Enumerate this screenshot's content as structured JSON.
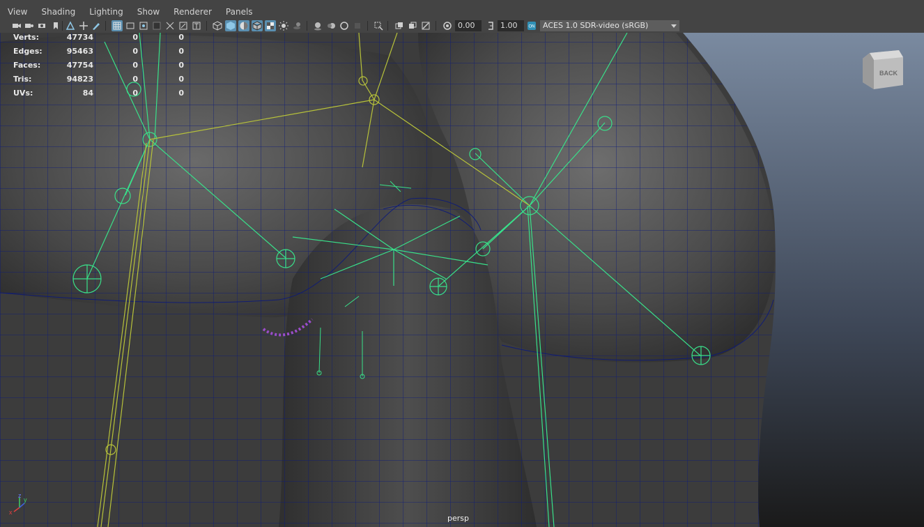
{
  "menubar": {
    "items": [
      "View",
      "Shading",
      "Lighting",
      "Show",
      "Renderer",
      "Panels"
    ]
  },
  "toolbar": {
    "near_value": "0.00",
    "far_value": "1.00",
    "color_space": "ACES 1.0 SDR-video (sRGB)",
    "icons": [
      "camera-icon",
      "select-camera-icon",
      "camera-attributes-icon",
      "bookmark-icon",
      "image-plane-icon",
      "2d-pan-zoom-icon",
      "grease-pencil-icon",
      "grid-icon",
      "film-gate-icon",
      "resolution-gate-icon",
      "gate-mask-icon",
      "field-chart-icon",
      "safe-action-icon",
      "safe-title-icon",
      "wireframe-icon",
      "smooth-shade-icon",
      "default-material-icon",
      "wireframe-on-shaded-icon",
      "textured-icon",
      "lighting-icon",
      "shadows-icon",
      "screen-space-ao-icon",
      "motion-blur-icon",
      "anti-aliasing-icon",
      "depth-of-field-icon",
      "isolate-select-icon",
      "xray-icon",
      "xray-active-components-icon",
      "xray-joints-icon",
      "backface-culling-icon",
      "exposure-icon",
      "gamma-icon",
      "color-management-icon"
    ]
  },
  "hud": {
    "rows": [
      {
        "label": "Verts:",
        "value": "47734",
        "sel": "0",
        "sel2": "0"
      },
      {
        "label": "Edges:",
        "value": "95463",
        "sel": "0",
        "sel2": "0"
      },
      {
        "label": "Faces:",
        "value": "47754",
        "sel": "0",
        "sel2": "0"
      },
      {
        "label": "Tris:",
        "value": "94823",
        "sel": "0",
        "sel2": "0"
      },
      {
        "label": "UVs:",
        "value": "84",
        "sel": "0",
        "sel2": "0"
      }
    ]
  },
  "viewport": {
    "camera_label": "persp",
    "view_cube_label": "BACK",
    "axis_labels": {
      "x": "x",
      "y": "y",
      "z": "z"
    },
    "colors": {
      "background_top": "#1b1b1b",
      "background_bottom": "#8fa3bd",
      "mesh_wire": "#0c1a7a",
      "joint_green": "#39e08a",
      "joint_yellow": "#b7c23a",
      "ui_bg": "#444444",
      "ui_text": "#d2d2d2"
    }
  }
}
